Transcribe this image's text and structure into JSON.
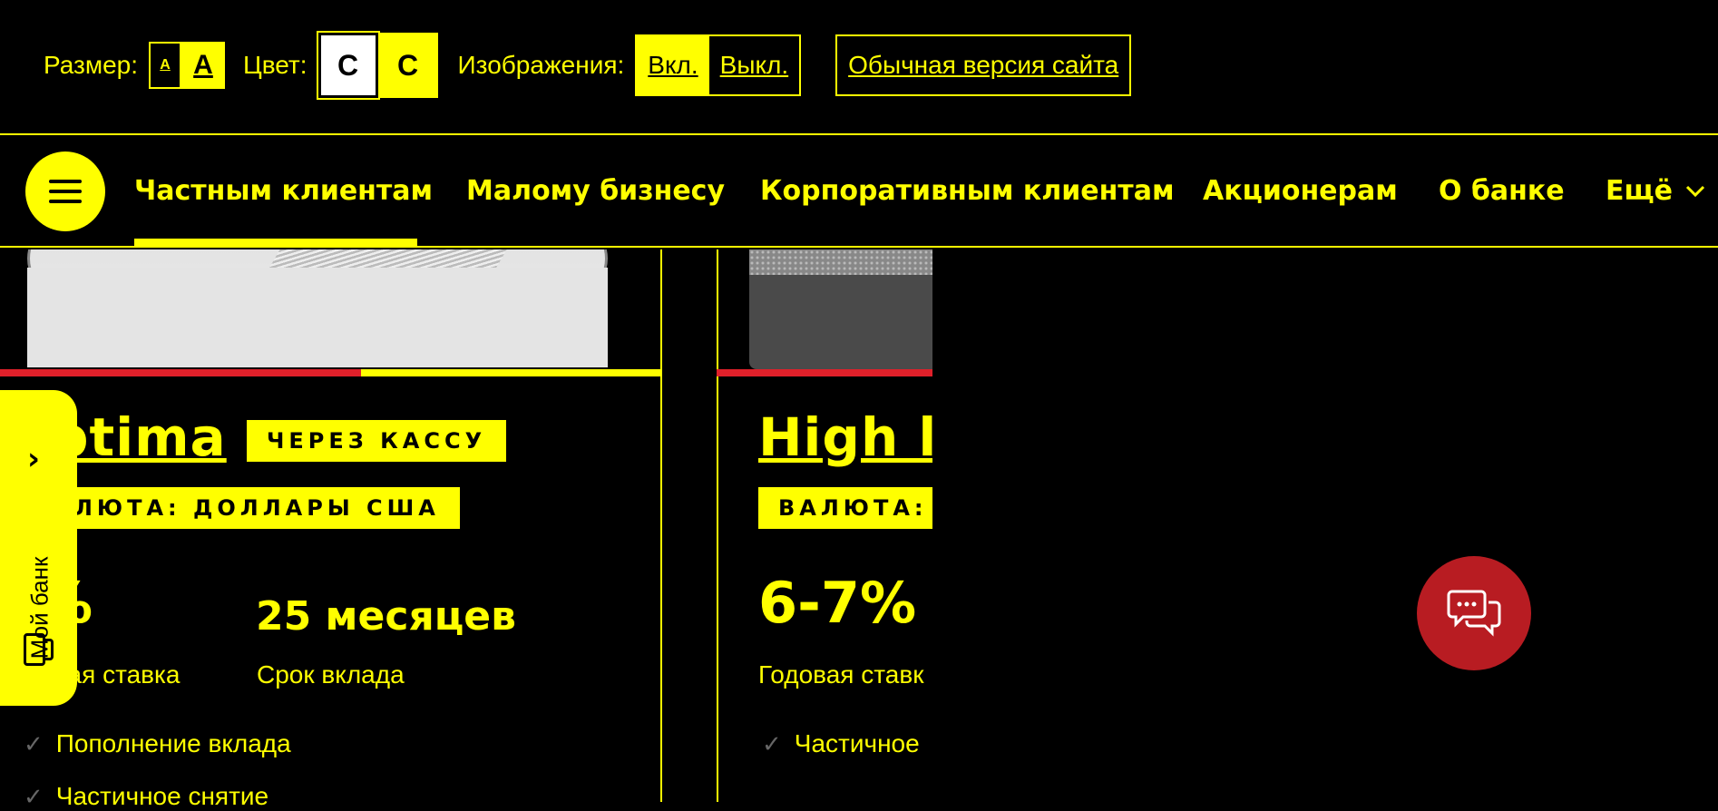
{
  "accessibility": {
    "size_label": "Размер:",
    "size_small": "A",
    "size_large": "A",
    "color_label": "Цвет:",
    "color_white": "С",
    "color_yellow": "С",
    "images_label": "Изображения:",
    "images_on": "Вкл.",
    "images_off": "Выкл.",
    "normal_version": "Обычная версия сайта"
  },
  "nav": {
    "menu_icon": "hamburger-icon",
    "items": [
      "Частным клиентам",
      "Малому бизнесу",
      "Корпоративным клиентам",
      "Акционерам",
      "О банке",
      "Ещё"
    ],
    "active": "Частным клиентам",
    "more_icon": "chevron-down-icon"
  },
  "cards": [
    {
      "title": "ptima",
      "tag": "ЧЕРЕЗ КАССУ",
      "currency": "ЛЮТА: ДОЛЛАРЫ США",
      "rate": "%",
      "rate_label": "вая ставка",
      "term": "25 месяцев",
      "term_label": "Срок вклада",
      "features": [
        "Пополнение вклада",
        "Частичное снятие"
      ]
    },
    {
      "title": "High l",
      "currency": "ВАЛЮТА:",
      "rate": "6-7%",
      "rate_label": "Годовая ставк",
      "features": [
        "Частичное"
      ]
    }
  ],
  "my_bank": {
    "label": "Мой банк",
    "expand_icon": "chevron-right-icon",
    "device_icon": "mobile-device-icon"
  },
  "chat": {
    "icon": "chat-icon"
  },
  "colors": {
    "background": "#000000",
    "accent": "#ffff00",
    "brand_red": "#e0202a",
    "chat_red": "#b81c22"
  }
}
